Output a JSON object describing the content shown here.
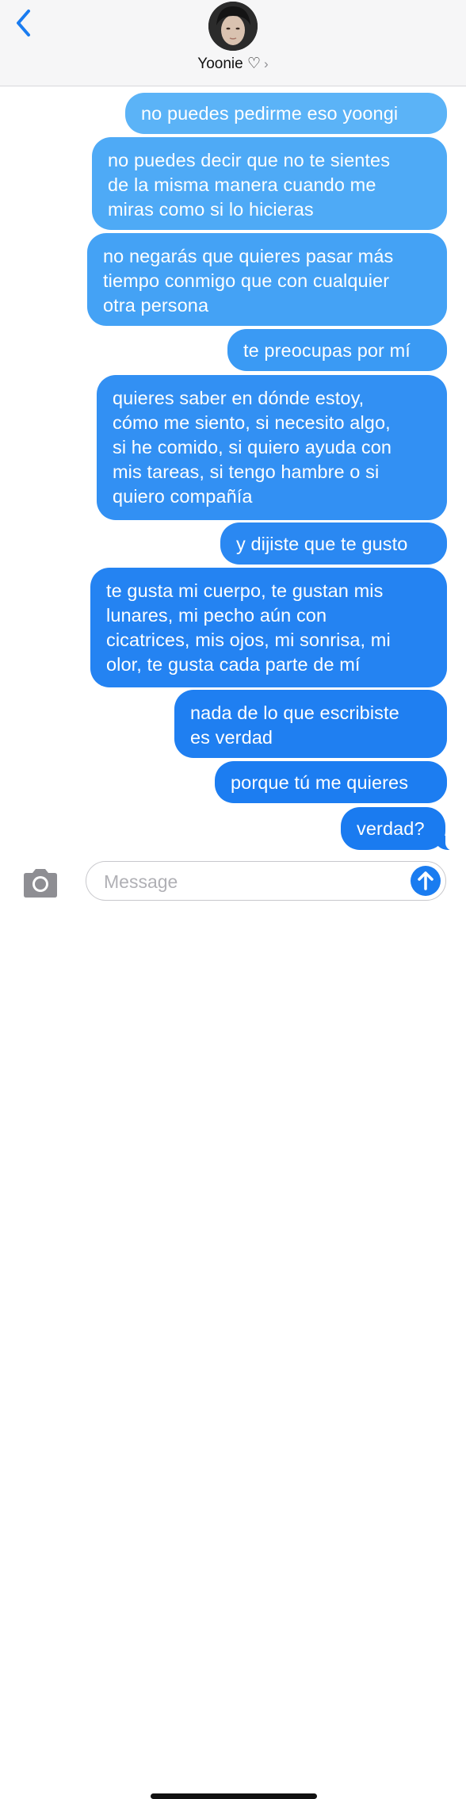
{
  "header": {
    "contact_name": "Yoonie ♡",
    "chevron": "›",
    "back_icon": "chevron-left-icon",
    "accent_color": "#1a7cf0"
  },
  "messages": [
    {
      "text": "no puedes pedirme eso yoongi",
      "color": "#5bb3f7"
    },
    {
      "text": "no puedes decir que no te sientes\nde la misma manera cuando me\nmiras como si lo hicieras",
      "color": "#4eaaf6"
    },
    {
      "text": "no negarás que quieres pasar más\ntiempo conmigo que con cualquier\notra persona",
      "color": "#44a2f5"
    },
    {
      "text": "te preocupas por mí",
      "color": "#3a9af4"
    },
    {
      "text": "quieres saber en dónde estoy,\ncómo me siento, si necesito algo,\nsi he comido, si quiero ayuda con\nmis tareas, si tengo hambre o si\nquiero compañía",
      "color": "#3290f3"
    },
    {
      "text": "y dijiste que te gusto",
      "color": "#2a88f2"
    },
    {
      "text": "te gusta mi cuerpo, te gustan mis\nlunares, mi pecho aún con\ncicatrices, mis ojos, mi sonrisa, mi\nolor, te gusta cada parte de mí",
      "color": "#2483f2"
    },
    {
      "text": "nada de lo que escribiste\nes verdad",
      "color": "#1f7ff1"
    },
    {
      "text": "porque tú me quieres",
      "color": "#1c7df1"
    },
    {
      "text": "verdad?",
      "color": "#1a7bf0"
    }
  ],
  "composer": {
    "placeholder": "Message",
    "camera_icon": "camera-icon",
    "send_icon": "arrow-up-icon"
  }
}
